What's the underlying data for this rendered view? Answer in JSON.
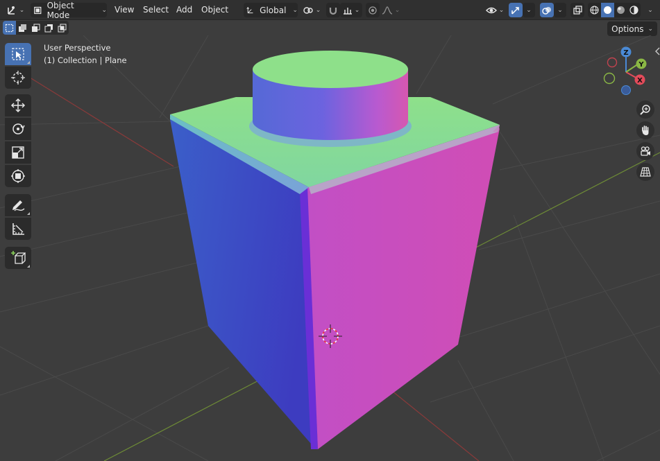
{
  "header": {
    "editor_type_icon": "orientation-gizmo-icon",
    "mode_label": "Object Mode",
    "menus": [
      "View",
      "Select",
      "Add",
      "Object"
    ],
    "transform_orientation": "Global",
    "pivot_icon": "link-pivot-icon",
    "snap_icon": "magnet-icon",
    "snap_target_icon": "snap-increment-icon",
    "proportional_icon": "proportional-edit-icon",
    "falloff_icon": "falloff-curve-icon",
    "visibility_icon": "eye-icon",
    "gizmo_icon": "gizmo-arrows-icon",
    "overlay_icon": "overlay-circles-icon",
    "xray_icon": "xray-icon",
    "shading_modes": [
      "wireframe",
      "solid",
      "material-preview",
      "rendered"
    ],
    "active_shading": "solid"
  },
  "subbar": {
    "select_modes": [
      "new",
      "extend",
      "subtract",
      "invert",
      "intersect"
    ],
    "options_label": "Options"
  },
  "viewport": {
    "perspective_label": "User Perspective",
    "collection_label": "(1) Collection | Plane"
  },
  "toolbar": {
    "tools": [
      "select-box",
      "cursor",
      "move",
      "rotate",
      "scale",
      "transform",
      "annotate",
      "measure",
      "add-cube"
    ],
    "active": "select-box"
  },
  "nav_gizmo": {
    "z": "Z",
    "y": "Y",
    "x": "X"
  },
  "nav_buttons": [
    "zoom-icon",
    "hand-pan-icon",
    "camera-icon",
    "grid-perspective-icon"
  ],
  "colors": {
    "accent": "#4772b3",
    "axis_x": "#e34b5a",
    "axis_y": "#8bb845",
    "axis_z": "#4a8ad6"
  }
}
